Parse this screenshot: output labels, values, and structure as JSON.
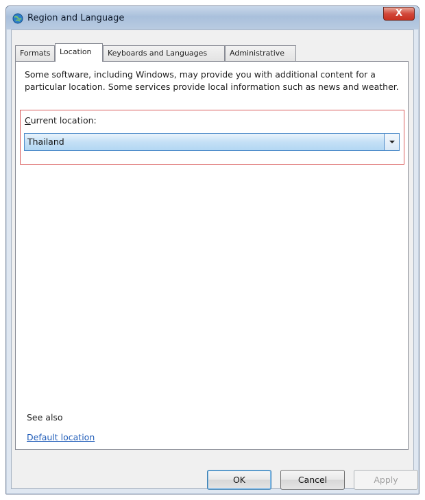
{
  "window": {
    "title": "Region and Language",
    "close_label": "X"
  },
  "tabs": [
    {
      "label": "Formats"
    },
    {
      "label": "Location"
    },
    {
      "label": "Keyboards and Languages"
    },
    {
      "label": "Administrative"
    }
  ],
  "location": {
    "description": "Some software, including Windows, may provide you with additional content for a particular location. Some services provide local information such as news and weather.",
    "current_location_label_first": "C",
    "current_location_label_rest": "urrent location:",
    "current_location_value": "Thailand"
  },
  "see_also": {
    "label": "See also",
    "link": "Default location"
  },
  "buttons": {
    "ok": "OK",
    "cancel": "Cancel",
    "apply": "Apply"
  },
  "colors": {
    "highlight_border": "#d95a5a",
    "link": "#1e5bb8",
    "combo_selected": "#b3d7f3"
  },
  "icons": [
    "globe-icon",
    "close-icon",
    "chevron-down-icon"
  ]
}
